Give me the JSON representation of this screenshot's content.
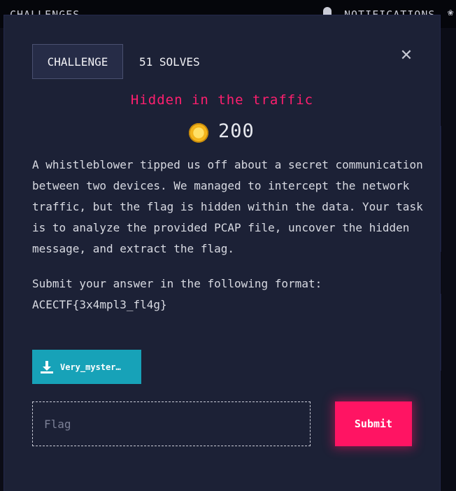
{
  "topbar": {
    "challenges_label": "CHALLENGES",
    "notifications_label": "NOTIFICATIONS"
  },
  "modal": {
    "tabs": [
      {
        "label": "CHALLENGE"
      },
      {
        "label": "51 SOLVES"
      }
    ],
    "title": "Hidden in the traffic",
    "points": "200",
    "description": [
      "A whistleblower tipped us off about a secret communication between two devices. We managed to intercept the network traffic, but the flag is hidden within the data. Your task is to analyze the provided PCAP file, uncover the hidden message, and extract the flag.",
      "Submit your answer in the following format: ACECTF{3x4mpl3_fl4g}"
    ],
    "download_label": "Very_myster…",
    "flag_placeholder": "Flag",
    "flag_value": "",
    "submit_label": "Submit"
  },
  "icons": {
    "close": "close-icon",
    "coin": "coin-icon",
    "download": "download-icon",
    "bell": "bell-icon",
    "paw": "paw-icon"
  },
  "colors": {
    "accent": "#ff1463",
    "title": "#ff1f6f",
    "download_bg": "#17a2b8",
    "modal_bg": "#1c2136"
  }
}
